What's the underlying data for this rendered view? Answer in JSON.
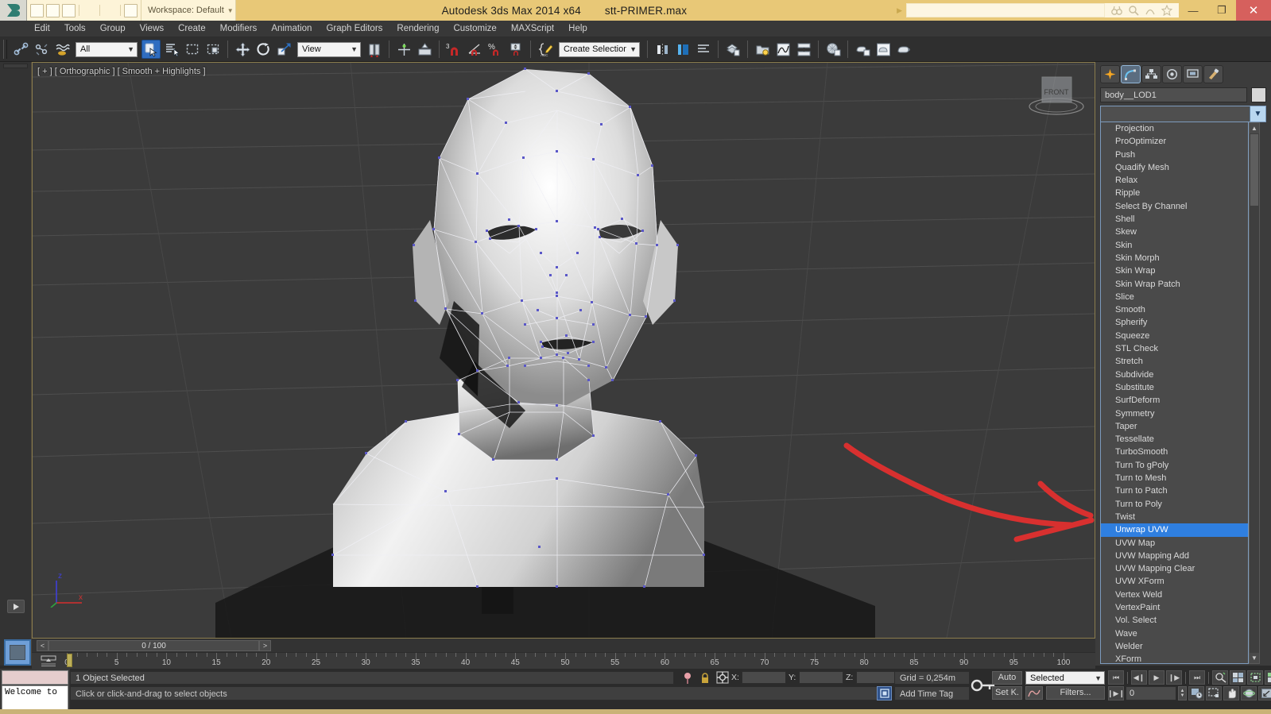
{
  "titlebar": {
    "workspace_label": "Workspace: Default",
    "app_title": "Autodesk 3ds Max  2014 x64",
    "file_name": "stt-PRIMER.max",
    "minimize": "—",
    "restore": "❐",
    "close": "✕"
  },
  "menu": {
    "items": [
      "Edit",
      "Tools",
      "Group",
      "Views",
      "Create",
      "Modifiers",
      "Animation",
      "Graph Editors",
      "Rendering",
      "Customize",
      "MAXScript",
      "Help"
    ]
  },
  "toolbar": {
    "selection_filter": "All",
    "reference_coord": "View",
    "named_selection_sets": "Create Selection Se",
    "snap_value": "3"
  },
  "viewport": {
    "label": "[ + ] [ Orthographic ] [ Smooth + Highlights ]",
    "viewcube_face": "FRONT",
    "axis_x": "x",
    "axis_z": "z"
  },
  "command_panel": {
    "tabs": [
      "create-tab",
      "modify-tab",
      "hierarchy-tab",
      "motion-tab",
      "display-tab",
      "utilities-tab"
    ],
    "active_tab_index": 1,
    "object_name": "body__LOD1",
    "modifier_list_value": "",
    "selected_modifier": "Unwrap UVW",
    "modifiers": [
      "Projection",
      "ProOptimizer",
      "Push",
      "Quadify Mesh",
      "Relax",
      "Ripple",
      "Select By Channel",
      "Shell",
      "Skew",
      "Skin",
      "Skin Morph",
      "Skin Wrap",
      "Skin Wrap Patch",
      "Slice",
      "Smooth",
      "Spherify",
      "Squeeze",
      "STL Check",
      "Stretch",
      "Subdivide",
      "Substitute",
      "SurfDeform",
      "Symmetry",
      "Taper",
      "Tessellate",
      "TurboSmooth",
      "Turn To gPoly",
      "Turn to Mesh",
      "Turn to Patch",
      "Turn to Poly",
      "Twist",
      "Unwrap UVW",
      "UVW Map",
      "UVW Mapping Add",
      "UVW Mapping Clear",
      "UVW XForm",
      "Vertex Weld",
      "VertexPaint",
      "Vol. Select",
      "Wave",
      "Welder",
      "XForm"
    ]
  },
  "time_slider": {
    "prev_label": "<",
    "next_label": ">",
    "value": "0 / 100"
  },
  "track_bar": {
    "ticks": [
      "0",
      "5",
      "10",
      "15",
      "20",
      "25",
      "30",
      "35",
      "40",
      "45",
      "50",
      "55",
      "60",
      "65",
      "70",
      "75",
      "80",
      "85",
      "90",
      "95",
      "100"
    ]
  },
  "mini_listener": {
    "text": "Welcome to"
  },
  "status_bar": {
    "selection_status": "1 Object Selected",
    "prompt": "Click or click-and-drag to select objects",
    "coord_x_label": "X:",
    "coord_y_label": "Y:",
    "coord_z_label": "Z:",
    "coord_x_value": "",
    "coord_y_value": "",
    "coord_z_value": "",
    "grid_info": "Grid = 0,254m",
    "add_time_tag": "Add Time Tag",
    "auto_key": "Auto",
    "set_key": "Set K.",
    "selection_set": "Selected",
    "filters": "Filters...",
    "frame_value": "0"
  },
  "colors": {
    "title_bar": "#e8c877",
    "accent_blue": "#2f7fe0",
    "panel_bg": "#3c3c3c",
    "viewport_bg": "#3b3b3b",
    "close_red": "#d6605d",
    "annotation_red": "#d8302f"
  }
}
